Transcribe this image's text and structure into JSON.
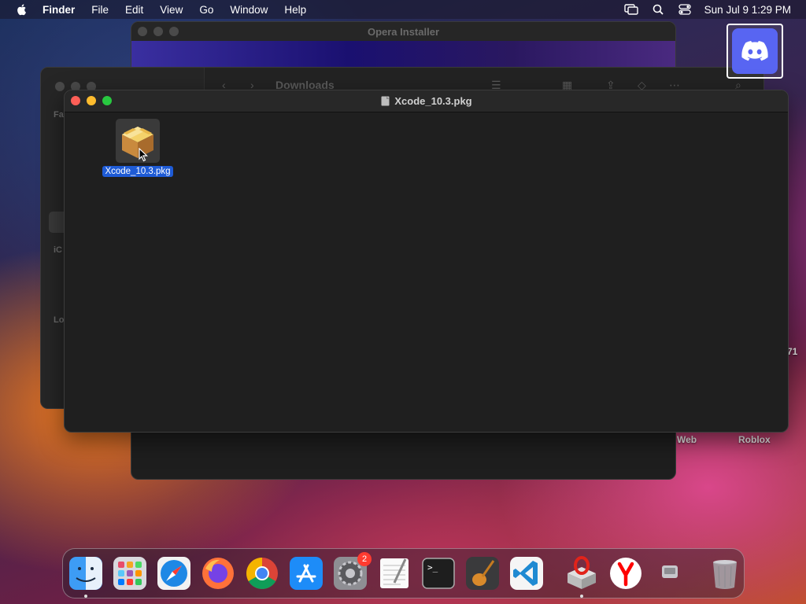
{
  "menubar": {
    "app_name": "Finder",
    "items": [
      "File",
      "Edit",
      "View",
      "Go",
      "Window",
      "Help"
    ],
    "clock": "Sun Jul 9  1:29 PM"
  },
  "opera_window": {
    "title": "Opera Installer"
  },
  "downloads_window": {
    "title": "Downloads",
    "sidebar_labels": [
      "Fa",
      "iC",
      "Lo"
    ]
  },
  "main_window": {
    "title": "Xcode_10.3.pkg",
    "file": {
      "name": "Xcode_10.3.pkg",
      "icon": "package-icon",
      "selected": true
    }
  },
  "desktop": {
    "icons": [
      {
        "name": "discord-icon",
        "label": ""
      },
      {
        "label": "Roblox"
      },
      {
        "label": "Web"
      },
      {
        "label": "71"
      }
    ]
  },
  "dock": {
    "apps": [
      {
        "name": "Finder",
        "icon": "finder-icon",
        "running": true
      },
      {
        "name": "Launchpad",
        "icon": "launchpad-icon"
      },
      {
        "name": "Safari",
        "icon": "safari-icon"
      },
      {
        "name": "Firefox",
        "icon": "firefox-icon"
      },
      {
        "name": "Chrome",
        "icon": "chrome-icon"
      },
      {
        "name": "App Store",
        "icon": "app-store-icon"
      },
      {
        "name": "System Preferences",
        "icon": "system-preferences-icon",
        "badge": "2"
      },
      {
        "name": "TextEdit",
        "icon": "textedit-icon"
      },
      {
        "name": "Terminal",
        "icon": "terminal-icon"
      },
      {
        "name": "GarageBand",
        "icon": "garageband-icon"
      },
      {
        "name": "Visual Studio Code",
        "icon": "vscode-icon"
      }
    ],
    "recent": [
      {
        "name": "Opera Installer",
        "icon": "opera-installer-icon",
        "running": true
      },
      {
        "name": "Yandex",
        "icon": "yandex-icon"
      },
      {
        "name": "Disk Image",
        "icon": "disk-image-icon"
      }
    ],
    "trash": {
      "name": "Trash",
      "icon": "trash-icon"
    }
  },
  "colors": {
    "selection": "#1e5bd6",
    "close": "#ff5f57",
    "minimize": "#febc2e",
    "zoom": "#28c840"
  }
}
